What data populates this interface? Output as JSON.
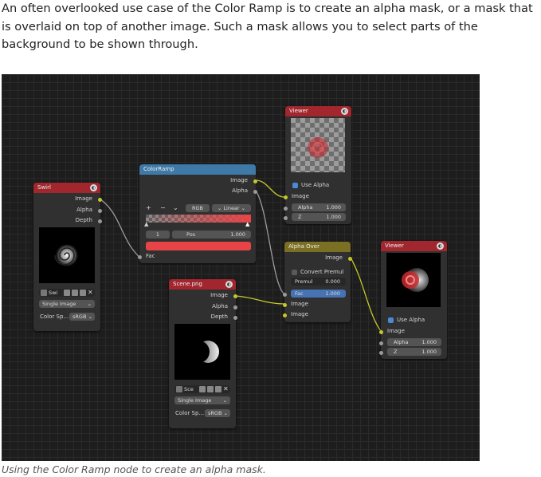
{
  "intro_text": "An often overlooked use case of the Color Ramp is to create an alpha mask, or a mask that is overlaid on top of another image. Such a mask allows you to select parts of the background to be shown through.",
  "caption": "Using the Color Ramp node to create an alpha mask.",
  "nodes": {
    "swirl": {
      "title": "Swirl",
      "outputs": [
        "Image",
        "Alpha",
        "Depth"
      ],
      "image_name": "Swi",
      "source": "Single Image",
      "color_space_label": "Color Sp...",
      "color_space": "sRGB"
    },
    "colorramp": {
      "title": "ColorRamp",
      "outputs": [
        "Image",
        "Alpha"
      ],
      "mode": "RGB",
      "interpolation": "Linear",
      "stop_index": "1",
      "pos_label": "Pos",
      "pos_value": "1.000",
      "input": "Fac",
      "selected_color": "#e84448"
    },
    "scene": {
      "title": "Scene.png",
      "outputs": [
        "Image",
        "Alpha",
        "Depth"
      ],
      "image_name": "Sce",
      "source": "Single Image",
      "color_space_label": "Color Sp...",
      "color_space": "sRGB"
    },
    "viewer_top": {
      "title": "Viewer",
      "use_alpha": "Use Alpha",
      "inputs": [
        "Image",
        "Alpha",
        "Z"
      ],
      "alpha_value": "1.000",
      "z_value": "1.000"
    },
    "alpha_over": {
      "title": "Alpha Over",
      "output": "Image",
      "convert_premul": "Convert Premul",
      "premul_label": "Premul",
      "premul_value": "0.000",
      "fac_label": "Fac",
      "fac_value": "1.000",
      "inputs": [
        "Image",
        "Image"
      ]
    },
    "viewer_bottom": {
      "title": "Viewer",
      "use_alpha": "Use Alpha",
      "inputs": [
        "Image",
        "Alpha",
        "Z"
      ],
      "alpha_value": "1.000",
      "z_value": "1.000"
    }
  }
}
